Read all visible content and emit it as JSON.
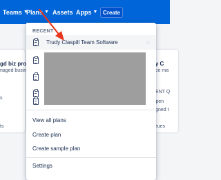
{
  "nav": {
    "teams": "Teams",
    "plans": "Plans",
    "assets": "Assets",
    "apps": "Apps",
    "create": "Create",
    "chevron": "chevron-down-icon"
  },
  "background": {
    "left_title": "gd biz proje",
    "left_sub": "naged business",
    "left_i": "s",
    "right_title": "dy C",
    "right_sub": "vice ma",
    "right_recent": "CENT Q",
    "right_open": "Open",
    "right_assigned": "signed t",
    "left_bottom": "ts",
    "right_bottom": "ueues"
  },
  "dropdown": {
    "recent_label": "RECENT",
    "recent_items": [
      {
        "label": "Trudy Claspill Team Software",
        "icon": "clipboard-icon",
        "starred": false
      },
      {
        "label": "",
        "icon": "clipboard-icon"
      },
      {
        "label": "",
        "icon": "clipboard-icon"
      },
      {
        "label": "",
        "icon": "clipboard-icon"
      },
      {
        "label": "",
        "icon": "clipboard-icon"
      }
    ],
    "view_all": "View all plans",
    "create_plan": "Create plan",
    "create_sample": "Create sample plan",
    "settings": "Settings"
  },
  "colors": {
    "nav_bg": "#0065d9",
    "create_bg": "#0052cc",
    "annotation_arrow": "#e8361e"
  }
}
